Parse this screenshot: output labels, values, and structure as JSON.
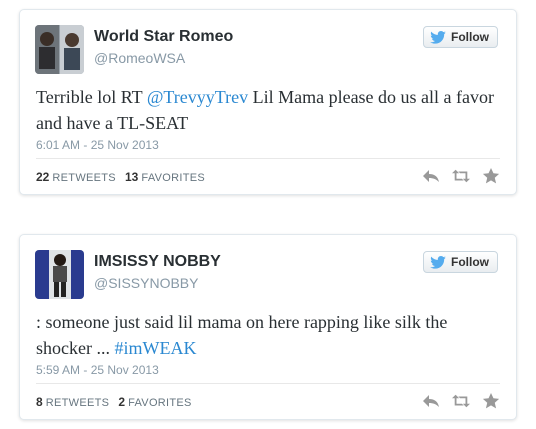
{
  "tweets": [
    {
      "name": "World Star Romeo",
      "handle": "@RomeoWSA",
      "follow_label": "Follow",
      "text_parts": {
        "before": "Terrible lol RT ",
        "mention": "@TrevyyTrev",
        "after": " Lil Mama please do us all a favor and have a TL-SEAT"
      },
      "time": "6:01 AM - 25 Nov 2013",
      "retweets_count": "22",
      "retweets_label": "RETWEETS",
      "favorites_count": "13",
      "favorites_label": "FAVORITES",
      "icons": [
        "reply-icon",
        "retweet-icon",
        "favorite-star-icon"
      ]
    },
    {
      "name": "IMSISSY NOBBY",
      "handle": "@SISSYNOBBY",
      "follow_label": "Follow",
      "text_parts": {
        "before": ": someone just said lil mama on here rapping like silk the shocker ... ",
        "hashtag": "#imWEAK"
      },
      "time": "5:59 AM - 25 Nov 2013",
      "retweets_count": "8",
      "retweets_label": "RETWEETS",
      "favorites_count": "2",
      "favorites_label": "FAVORITES",
      "icons": [
        "reply-icon",
        "retweet-icon",
        "favorite-star-icon"
      ]
    }
  ],
  "colors": {
    "link": "#2a88d1",
    "bird": "#55acee",
    "action_icon": "#999999"
  }
}
